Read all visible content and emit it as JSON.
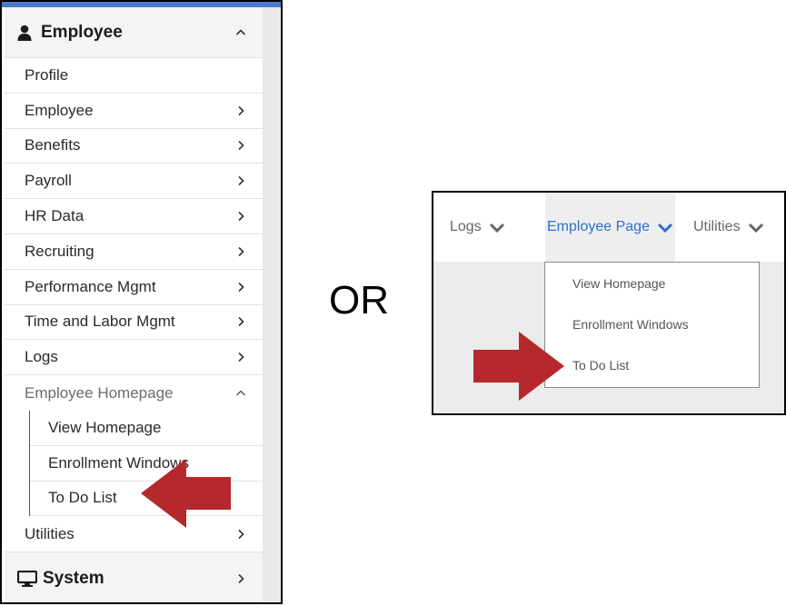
{
  "left_menu": {
    "header": {
      "label": "Employee",
      "icon": "user-icon"
    },
    "items": [
      {
        "label": "Profile"
      },
      {
        "label": "Employee"
      },
      {
        "label": "Benefits"
      },
      {
        "label": "Payroll"
      },
      {
        "label": "HR Data"
      },
      {
        "label": "Recruiting"
      },
      {
        "label": "Performance Mgmt"
      },
      {
        "label": "Time and Labor Mgmt"
      },
      {
        "label": "Logs"
      },
      {
        "label": "Employee Homepage"
      }
    ],
    "subitems": [
      {
        "label": "View Homepage"
      },
      {
        "label": "Enrollment Windows"
      },
      {
        "label": "To Do List"
      }
    ],
    "after_items": [
      {
        "label": "Utilities"
      }
    ],
    "footer": {
      "label": "System",
      "icon": "monitor-icon"
    }
  },
  "separator": {
    "label": "OR"
  },
  "top_nav": {
    "items": [
      {
        "label": "Logs"
      },
      {
        "label": "Employee Page"
      },
      {
        "label": "Utilities"
      }
    ],
    "dropdown": [
      {
        "label": "View Homepage"
      },
      {
        "label": "Enrollment Windows"
      },
      {
        "label": "To Do List"
      }
    ]
  },
  "colors": {
    "accent_blue": "#2f6fd0",
    "arrow_red": "#b5282b",
    "top_bar_blue": "#4a7ac9"
  }
}
